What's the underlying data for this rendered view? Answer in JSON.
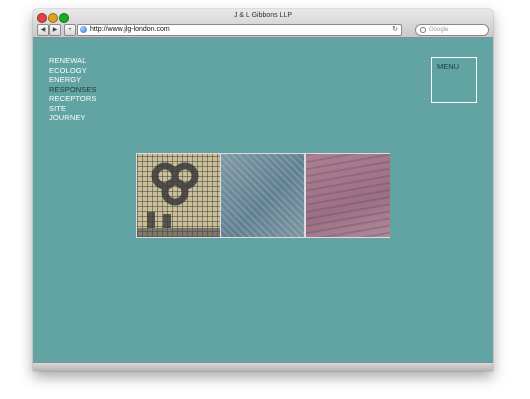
{
  "window": {
    "title": "J & L Gibbons LLP"
  },
  "toolbar": {
    "back_label": "◀",
    "forward_label": "▶",
    "add_label": "+",
    "url": "http://www.jlg-london.com",
    "reload_label": "↻",
    "search_placeholder": "Google"
  },
  "nav": {
    "items": [
      {
        "label": "RENEWAL"
      },
      {
        "label": "ECOLOGY"
      },
      {
        "label": "ENERGY"
      },
      {
        "label": "RESPONSES",
        "active": true
      },
      {
        "label": "RECEPTORS"
      },
      {
        "label": "SITE"
      },
      {
        "label": "JOURNEY"
      }
    ]
  },
  "menu": {
    "label": "MENU"
  },
  "colors": {
    "page_background": "#62a4a3",
    "nav_text": "#ffffff",
    "nav_active_text": "#1f3a3a"
  },
  "gallery": {
    "images": [
      {
        "name": "mosaic-cobblestone-image"
      },
      {
        "name": "blue-grey-stone-texture-image"
      },
      {
        "name": "pink-sand-ripples-image"
      }
    ]
  }
}
